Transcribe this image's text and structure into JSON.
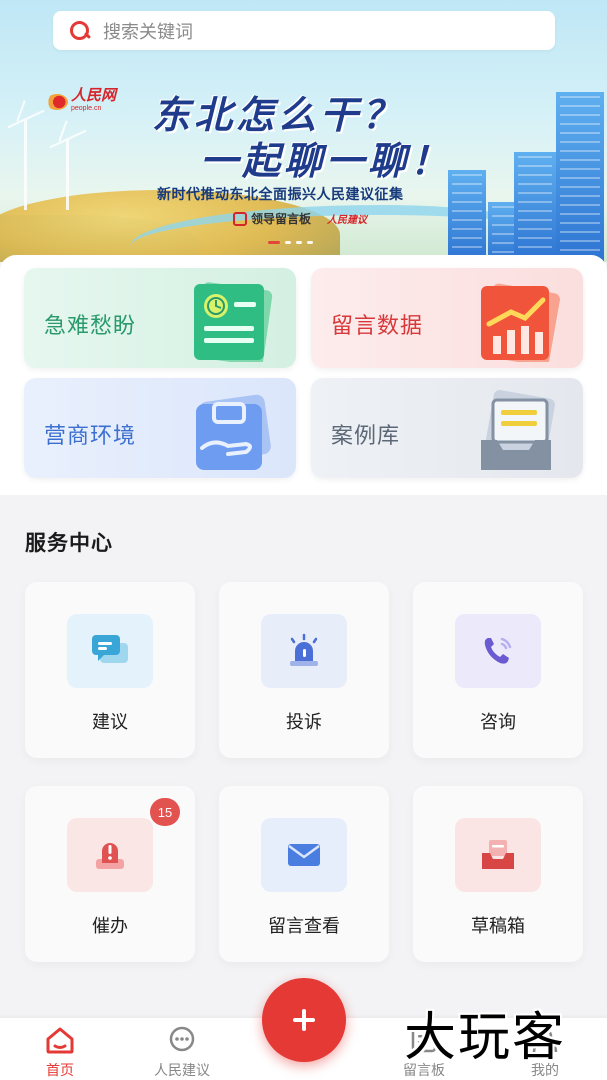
{
  "search": {
    "placeholder": "搜索关键词"
  },
  "banner": {
    "logo_name": "人民网",
    "logo_domain": "people.cn",
    "headline_line1": "东北怎么干？",
    "headline_line2": "一起聊一聊！",
    "subtitle": "新时代推动东北全面振兴人民建议征集",
    "tag_board": "领导留言板",
    "tag_suggest": "人民建议",
    "carousel_pages": 4,
    "carousel_active": 1
  },
  "quick_entries": [
    {
      "label": "急难愁盼",
      "icon": "document-clock-icon",
      "color": "#2a9a6c"
    },
    {
      "label": "留言数据",
      "icon": "bar-chart-icon",
      "color": "#d8383a"
    },
    {
      "label": "营商环境",
      "icon": "briefcase-hand-icon",
      "color": "#3c6fd0"
    },
    {
      "label": "案例库",
      "icon": "archive-tray-icon",
      "color": "#5d6877"
    }
  ],
  "service_center": {
    "title": "服务中心",
    "items": [
      {
        "label": "建议",
        "icon": "chat-bubbles-icon",
        "color": "#3aa6d8"
      },
      {
        "label": "投诉",
        "icon": "alarm-light-icon",
        "color": "#4a6fd6"
      },
      {
        "label": "咨询",
        "icon": "phone-icon",
        "color": "#6a5bd0"
      },
      {
        "label": "催办",
        "icon": "urgent-alert-icon",
        "color": "#e05252"
      },
      {
        "label": "留言查看",
        "icon": "envelope-icon",
        "color": "#4a7de0"
      },
      {
        "label": "草稿箱",
        "icon": "draft-box-icon",
        "color": "#d84545"
      }
    ],
    "urge_badge": "15"
  },
  "bottom_nav": {
    "items": [
      {
        "label": "首页",
        "icon": "home-icon",
        "active": true
      },
      {
        "label": "人民建议",
        "icon": "chat-dots-icon",
        "active": false
      },
      {
        "label": "留言板",
        "icon": "board-icon",
        "active": false
      },
      {
        "label": "我的",
        "icon": "user-icon",
        "active": false
      }
    ],
    "fab_icon": "plus-icon"
  },
  "watermark": "大玩客",
  "colors": {
    "accent": "#e53935",
    "background": "#f3f3f5"
  }
}
